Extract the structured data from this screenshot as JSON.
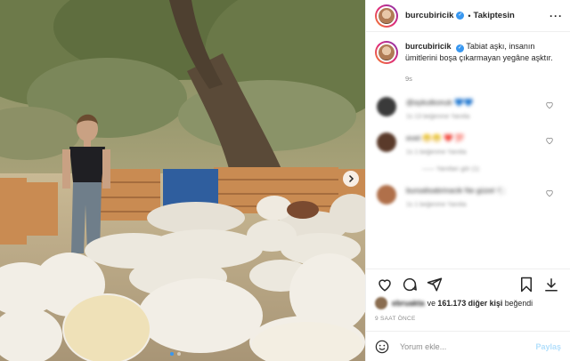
{
  "post": {
    "username": "burcubiricik",
    "separator": "•",
    "follow_status": "Takiptesin",
    "more_icon": "more-horizontal-icon",
    "caption_text": "Tabiat aşkı, insanın ümitlerini boşa çıkarmayan yegâne aşktır.",
    "caption_age": "9s",
    "comments": [
      {
        "text": "@aykutkonuk 💙💙",
        "meta": "1s  13 beğenme  Yanıtla"
      },
      {
        "text": "evet 😁😁 ❤️ 💯",
        "meta": "1s  1 beğenme  Yanıtla",
        "replies": "—— Yanıtları gör (1)"
      },
      {
        "text": "bursalisabrinacik Ne güzel 🐑",
        "meta": "1s  1 beğenme  Yanıtla"
      }
    ],
    "likes_prefix": "ve",
    "likes_count": "161.173 diğer kişi",
    "likes_suffix": "beğendi",
    "likes_blur_name": "ebruakta",
    "time_ago": "9 SAAT ÖNCE",
    "comment_placeholder": "Yorum ekle...",
    "post_button": "Paylaş",
    "carousel": {
      "current": 1,
      "total": 2
    }
  },
  "icons": [
    "heart-icon",
    "comment-icon",
    "share-icon",
    "bookmark-icon",
    "download-icon",
    "emoji-icon",
    "chevron-right-icon",
    "verified-badge-icon"
  ],
  "colors": {
    "accent": "#3897f0",
    "post_button_disabled": "#b2dffc",
    "muted": "#8e8e8e",
    "border": "#efefef"
  }
}
